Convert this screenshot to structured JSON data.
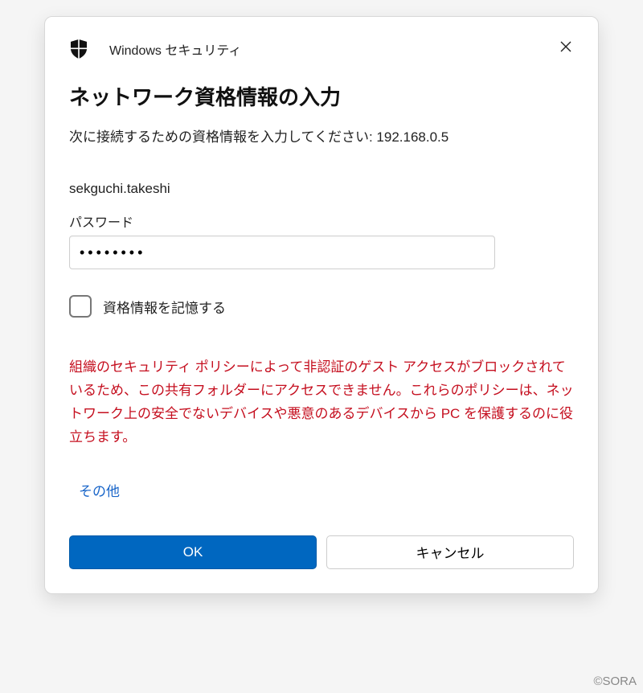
{
  "header": {
    "title": "Windows セキュリティ"
  },
  "dialog": {
    "heading": "ネットワーク資格情報の入力",
    "prompt": "次に接続するための資格情報を入力してください: 192.168.0.5",
    "username": "sekguchi.takeshi",
    "password_label": "パスワード",
    "password_value": "●●●●●●●●",
    "remember_label": "資格情報を記憶する",
    "remember_checked": false,
    "error_message": "組織のセキュリティ ポリシーによって非認証のゲスト アクセスがブロックされているため、この共有フォルダーにアクセスできません。これらのポリシーは、ネットワーク上の安全でないデバイスや悪意のあるデバイスから PC を保護するのに役立ちます。",
    "more_link": "その他",
    "ok_label": "OK",
    "cancel_label": "キャンセル"
  },
  "watermark": "©SORA"
}
